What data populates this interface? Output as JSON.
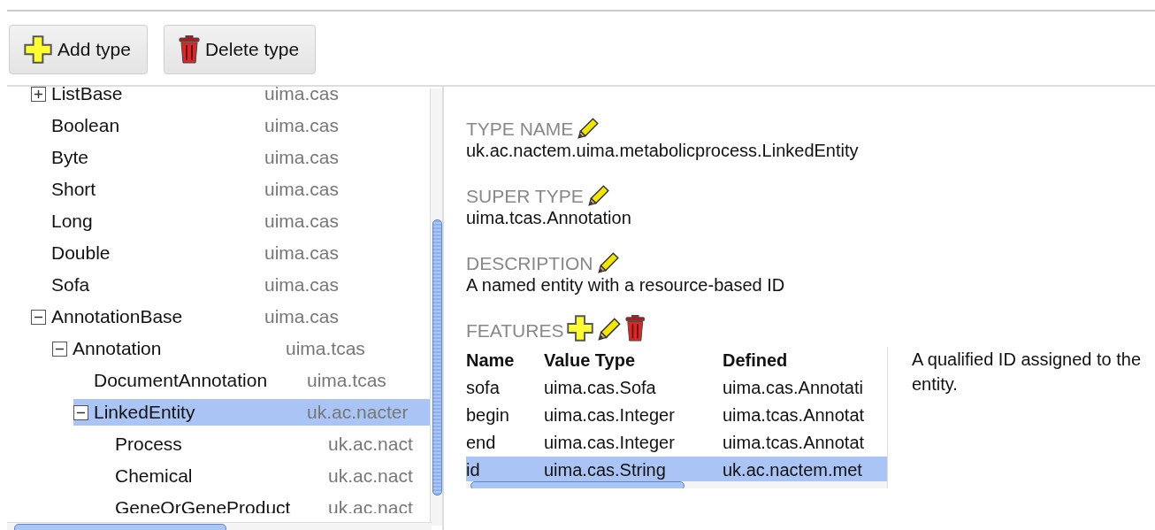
{
  "toolbar": {
    "buttons": [
      {
        "kind": "add",
        "label": "Add type"
      },
      {
        "kind": "delete",
        "label": "Delete type"
      }
    ]
  },
  "tree": [
    {
      "name": "ListBase",
      "package": "uima.cas",
      "expanded": false,
      "selected": false
    },
    {
      "name": "Boolean",
      "package": "uima.cas",
      "selected": false
    },
    {
      "name": "Byte",
      "package": "uima.cas",
      "selected": false
    },
    {
      "name": "Short",
      "package": "uima.cas",
      "selected": false
    },
    {
      "name": "Long",
      "package": "uima.cas",
      "selected": false
    },
    {
      "name": "Double",
      "package": "uima.cas",
      "selected": false
    },
    {
      "name": "Sofa",
      "package": "uima.cas",
      "selected": false
    },
    {
      "name": "AnnotationBase",
      "package": "uima.cas",
      "expanded": true,
      "selected": false,
      "children": [
        {
          "name": "Annotation",
          "package": "uima.tcas",
          "expanded": true,
          "selected": false,
          "children": [
            {
              "name": "DocumentAnnotation",
              "package": "uima.tcas",
              "selected": false
            },
            {
              "name": "LinkedEntity",
              "package": "uk.ac.nacter",
              "expanded": true,
              "selected": true,
              "children": [
                {
                  "name": "Process",
                  "package": "uk.ac.nact",
                  "selected": false
                },
                {
                  "name": "Chemical",
                  "package": "uk.ac.nact",
                  "selected": false
                },
                {
                  "name": "GeneOrGeneProduct",
                  "package": "uk.ac.nact",
                  "selected": false
                }
              ]
            }
          ]
        }
      ]
    }
  ],
  "details": {
    "sections": [
      {
        "label": "TYPE NAME",
        "value": "uk.ac.nactem.uima.metabolicprocess.LinkedEntity"
      },
      {
        "label": "SUPER TYPE",
        "value": "uima.tcas.Annotation"
      },
      {
        "label": "DESCRIPTION",
        "value": "A named entity with a resource-based ID"
      }
    ],
    "features": {
      "label": "FEATURES",
      "columns": [
        "Name",
        "Value Type",
        "Defined"
      ],
      "rows": [
        {
          "cells": [
            "sofa",
            "uima.cas.Sofa",
            "uima.cas.Annotati"
          ],
          "selected": false
        },
        {
          "cells": [
            "begin",
            "uima.cas.Integer",
            "uima.tcas.Annotat"
          ],
          "selected": false
        },
        {
          "cells": [
            "end",
            "uima.cas.Integer",
            "uima.tcas.Annotat"
          ],
          "selected": false
        },
        {
          "cells": [
            "id",
            "uima.cas.String",
            "uk.ac.nactem.met"
          ],
          "selected": true
        }
      ],
      "description": "A qualified ID assigned to the entity."
    }
  }
}
